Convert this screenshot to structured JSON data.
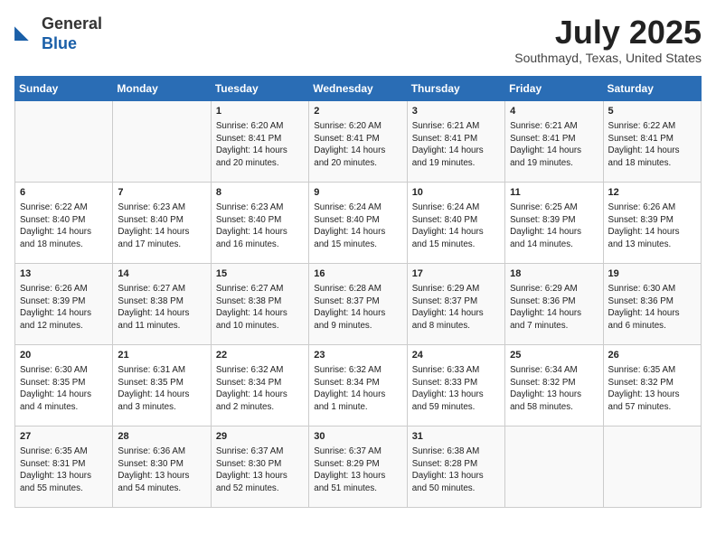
{
  "header": {
    "logo_general": "General",
    "logo_blue": "Blue",
    "month_title": "July 2025",
    "location": "Southmayd, Texas, United States"
  },
  "days_of_week": [
    "Sunday",
    "Monday",
    "Tuesday",
    "Wednesday",
    "Thursday",
    "Friday",
    "Saturday"
  ],
  "weeks": [
    [
      {
        "day": "",
        "info": ""
      },
      {
        "day": "",
        "info": ""
      },
      {
        "day": "1",
        "info": "Sunrise: 6:20 AM\nSunset: 8:41 PM\nDaylight: 14 hours and 20 minutes."
      },
      {
        "day": "2",
        "info": "Sunrise: 6:20 AM\nSunset: 8:41 PM\nDaylight: 14 hours and 20 minutes."
      },
      {
        "day": "3",
        "info": "Sunrise: 6:21 AM\nSunset: 8:41 PM\nDaylight: 14 hours and 19 minutes."
      },
      {
        "day": "4",
        "info": "Sunrise: 6:21 AM\nSunset: 8:41 PM\nDaylight: 14 hours and 19 minutes."
      },
      {
        "day": "5",
        "info": "Sunrise: 6:22 AM\nSunset: 8:41 PM\nDaylight: 14 hours and 18 minutes."
      }
    ],
    [
      {
        "day": "6",
        "info": "Sunrise: 6:22 AM\nSunset: 8:40 PM\nDaylight: 14 hours and 18 minutes."
      },
      {
        "day": "7",
        "info": "Sunrise: 6:23 AM\nSunset: 8:40 PM\nDaylight: 14 hours and 17 minutes."
      },
      {
        "day": "8",
        "info": "Sunrise: 6:23 AM\nSunset: 8:40 PM\nDaylight: 14 hours and 16 minutes."
      },
      {
        "day": "9",
        "info": "Sunrise: 6:24 AM\nSunset: 8:40 PM\nDaylight: 14 hours and 15 minutes."
      },
      {
        "day": "10",
        "info": "Sunrise: 6:24 AM\nSunset: 8:40 PM\nDaylight: 14 hours and 15 minutes."
      },
      {
        "day": "11",
        "info": "Sunrise: 6:25 AM\nSunset: 8:39 PM\nDaylight: 14 hours and 14 minutes."
      },
      {
        "day": "12",
        "info": "Sunrise: 6:26 AM\nSunset: 8:39 PM\nDaylight: 14 hours and 13 minutes."
      }
    ],
    [
      {
        "day": "13",
        "info": "Sunrise: 6:26 AM\nSunset: 8:39 PM\nDaylight: 14 hours and 12 minutes."
      },
      {
        "day": "14",
        "info": "Sunrise: 6:27 AM\nSunset: 8:38 PM\nDaylight: 14 hours and 11 minutes."
      },
      {
        "day": "15",
        "info": "Sunrise: 6:27 AM\nSunset: 8:38 PM\nDaylight: 14 hours and 10 minutes."
      },
      {
        "day": "16",
        "info": "Sunrise: 6:28 AM\nSunset: 8:37 PM\nDaylight: 14 hours and 9 minutes."
      },
      {
        "day": "17",
        "info": "Sunrise: 6:29 AM\nSunset: 8:37 PM\nDaylight: 14 hours and 8 minutes."
      },
      {
        "day": "18",
        "info": "Sunrise: 6:29 AM\nSunset: 8:36 PM\nDaylight: 14 hours and 7 minutes."
      },
      {
        "day": "19",
        "info": "Sunrise: 6:30 AM\nSunset: 8:36 PM\nDaylight: 14 hours and 6 minutes."
      }
    ],
    [
      {
        "day": "20",
        "info": "Sunrise: 6:30 AM\nSunset: 8:35 PM\nDaylight: 14 hours and 4 minutes."
      },
      {
        "day": "21",
        "info": "Sunrise: 6:31 AM\nSunset: 8:35 PM\nDaylight: 14 hours and 3 minutes."
      },
      {
        "day": "22",
        "info": "Sunrise: 6:32 AM\nSunset: 8:34 PM\nDaylight: 14 hours and 2 minutes."
      },
      {
        "day": "23",
        "info": "Sunrise: 6:32 AM\nSunset: 8:34 PM\nDaylight: 14 hours and 1 minute."
      },
      {
        "day": "24",
        "info": "Sunrise: 6:33 AM\nSunset: 8:33 PM\nDaylight: 13 hours and 59 minutes."
      },
      {
        "day": "25",
        "info": "Sunrise: 6:34 AM\nSunset: 8:32 PM\nDaylight: 13 hours and 58 minutes."
      },
      {
        "day": "26",
        "info": "Sunrise: 6:35 AM\nSunset: 8:32 PM\nDaylight: 13 hours and 57 minutes."
      }
    ],
    [
      {
        "day": "27",
        "info": "Sunrise: 6:35 AM\nSunset: 8:31 PM\nDaylight: 13 hours and 55 minutes."
      },
      {
        "day": "28",
        "info": "Sunrise: 6:36 AM\nSunset: 8:30 PM\nDaylight: 13 hours and 54 minutes."
      },
      {
        "day": "29",
        "info": "Sunrise: 6:37 AM\nSunset: 8:30 PM\nDaylight: 13 hours and 52 minutes."
      },
      {
        "day": "30",
        "info": "Sunrise: 6:37 AM\nSunset: 8:29 PM\nDaylight: 13 hours and 51 minutes."
      },
      {
        "day": "31",
        "info": "Sunrise: 6:38 AM\nSunset: 8:28 PM\nDaylight: 13 hours and 50 minutes."
      },
      {
        "day": "",
        "info": ""
      },
      {
        "day": "",
        "info": ""
      }
    ]
  ]
}
